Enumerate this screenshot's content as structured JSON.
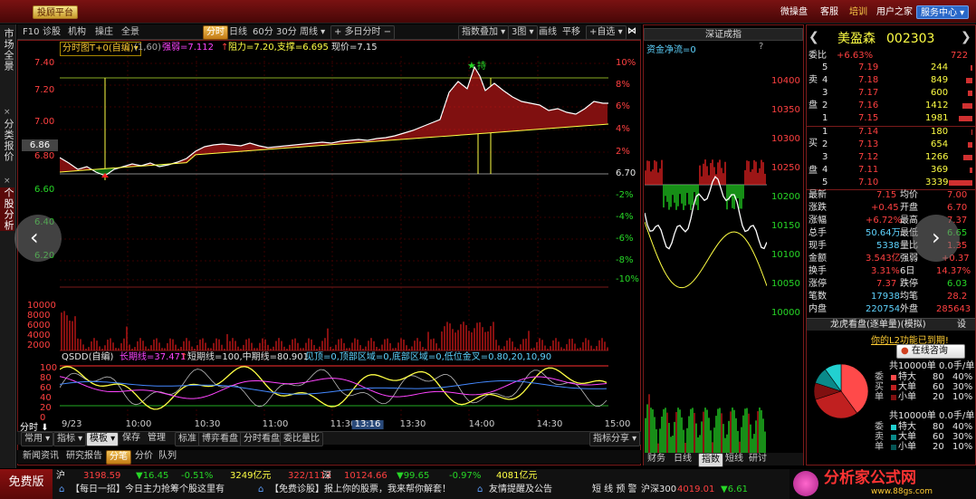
{
  "topbar": {
    "left_btn": "投顾平台",
    "right": [
      "微操盘",
      "客服",
      "培训",
      "用户之家"
    ],
    "service": "服务中心"
  },
  "side_tabs": [
    "市场全景",
    "分类报价",
    "个股分析"
  ],
  "toolbar": {
    "items": [
      "F10",
      "诊股",
      "机构",
      "操庄",
      "全景"
    ],
    "periods": [
      "分时",
      "日线",
      "60分",
      "30分",
      "周线"
    ],
    "multi": "多日分时",
    "right": [
      "指数叠加",
      "3图",
      "画线",
      "平移",
      "+自选"
    ]
  },
  "indicator_line": {
    "name": "分时图T+0(自编)",
    "params": "(1,60)",
    "strength": "强弱=7.112",
    "resist": "阻力=7.20,支撑=6.695",
    "now": "现价=7.15"
  },
  "price_axis": {
    "left": [
      "7.40",
      "7.20",
      "7.00",
      "6.86",
      "6.80",
      "6.60",
      "6.40",
      "6.20"
    ],
    "right": [
      "10%",
      "8%",
      "6%",
      "4%",
      "2%",
      "6.70",
      "-2%",
      "-4%",
      "-6%",
      "-8%",
      "-10%"
    ]
  },
  "chart_marks": {
    "buy": "★",
    "buy_label": "持"
  },
  "volume_axis": [
    "10000",
    "8000",
    "6000",
    "4000",
    "2000"
  ],
  "qsdd": {
    "title": "QSDD(自编)",
    "params": "长期线=37.471",
    "short": "短期线=100,中期线=80.901",
    "extra": "见顶=0,顶部区域=0,底部区域=0,低位金叉=0.80,20,10,90",
    "yaxis": [
      "100",
      "80",
      "60",
      "40",
      "20",
      "0"
    ]
  },
  "xaxis": {
    "times": [
      "9/23",
      "10:00",
      "10:30",
      "11:00",
      "11:30",
      "13:16",
      "13:30",
      "14:00",
      "14:30",
      "15:00"
    ],
    "left_label": "分时"
  },
  "bottom_tabs1": [
    "常用",
    "指标",
    "模板",
    "保存",
    "管理",
    "标准",
    "博弈看盘",
    "分时看盘",
    "委比量比"
  ],
  "bottom_tabs1_right": "指标分享",
  "bottom_tabs2": [
    "新闻资讯",
    "研究报告",
    "分笔",
    "分价",
    "队列"
  ],
  "mid": {
    "title": "深证成指",
    "net": "资金净流=0",
    "yaxis": [
      "10400",
      "10350",
      "10300",
      "10250",
      "10200",
      "10150",
      "10100",
      "10050",
      "10000"
    ],
    "tabs": [
      "财务",
      "日线",
      "指数",
      "短线",
      "研讨"
    ]
  },
  "stock": {
    "name": "美盈森",
    "code": "002303",
    "weibi_label": "委比",
    "weibi": "+6.63%",
    "weicha": "722",
    "sell": [
      {
        "lvl": "5",
        "p": "7.19",
        "v": "244"
      },
      {
        "lvl": "4",
        "p": "7.18",
        "v": "849"
      },
      {
        "lvl": "3",
        "p": "7.17",
        "v": "600"
      },
      {
        "lvl": "2",
        "p": "7.16",
        "v": "1412"
      },
      {
        "lvl": "1",
        "p": "7.15",
        "v": "1981"
      }
    ],
    "buy": [
      {
        "lvl": "1",
        "p": "7.14",
        "v": "180"
      },
      {
        "lvl": "2",
        "p": "7.13",
        "v": "654"
      },
      {
        "lvl": "3",
        "p": "7.12",
        "v": "1266"
      },
      {
        "lvl": "4",
        "p": "7.11",
        "v": "369"
      },
      {
        "lvl": "5",
        "p": "7.10",
        "v": "3339"
      }
    ],
    "sell_label": [
      "卖",
      "盘"
    ],
    "buy_label": [
      "买",
      "盘"
    ],
    "stats": [
      [
        "最新",
        "7.15",
        "均价",
        "7.00"
      ],
      [
        "涨跌",
        "+0.45",
        "开盘",
        "6.70"
      ],
      [
        "涨幅",
        "+6.72%",
        "最高",
        "7.37"
      ],
      [
        "总手",
        "50.64万",
        "最低",
        "6.65"
      ],
      [
        "现手",
        "5338",
        "量比",
        "1.35"
      ],
      [
        "金额",
        "3.543亿",
        "强弱",
        "+0.37"
      ],
      [
        "换手",
        "3.31%",
        "6日",
        "14.37%"
      ],
      [
        "涨停",
        "7.37",
        "跌停",
        "6.03"
      ],
      [
        "笔数",
        "17938",
        "均笔",
        "28.2"
      ],
      [
        "内盘",
        "220754",
        "外盘",
        "285643"
      ]
    ]
  },
  "dragon": {
    "title": "龙虎看盘(逐单量)(模拟)",
    "setting": "设",
    "trial": "你的L2功能已到期!",
    "consult": "在线咨询",
    "unit": "共10000单 0.0手/单",
    "wei_buy": "委买单",
    "wei_sell": "委卖单",
    "rows_buy": [
      [
        "特大",
        "80",
        "40%"
      ],
      [
        "大单",
        "60",
        "30%"
      ],
      [
        "小单",
        "20",
        "10%"
      ]
    ],
    "rows_sell": [
      [
        "特大",
        "80",
        "40%"
      ],
      [
        "大单",
        "60",
        "30%"
      ],
      [
        "小单",
        "20",
        "10%"
      ]
    ],
    "pie": [
      {
        "v": 40,
        "c": "#ff4a4a"
      },
      {
        "v": 30,
        "c": "#c02020"
      },
      {
        "v": 10,
        "c": "#801010"
      },
      {
        "v": 10,
        "c": "#0a8a8a"
      },
      {
        "v": 10,
        "c": "#22d0d0"
      }
    ]
  },
  "ticker": {
    "free": "免费版",
    "r1": [
      "沪",
      "3198.59",
      "▼16.45",
      "-0.51%",
      "3249亿元",
      "322/1113",
      "深",
      "10124.66",
      "▼99.65",
      "-0.97%",
      "4081亿元"
    ],
    "r2": [
      "【每日一招】今日主力抢筹个股这里有",
      "【免费诊股】报上你的股票，我来帮你解套！",
      "友情提醒及公告",
      "短 线 预 警",
      "沪深300",
      "4019.01",
      "▼6.61"
    ]
  },
  "logo": {
    "text": "分析家公式网",
    "url": "www.88gs.com"
  },
  "colors": {
    "up": "#ff4040",
    "down": "#27d827",
    "accent": "#ffff44"
  }
}
